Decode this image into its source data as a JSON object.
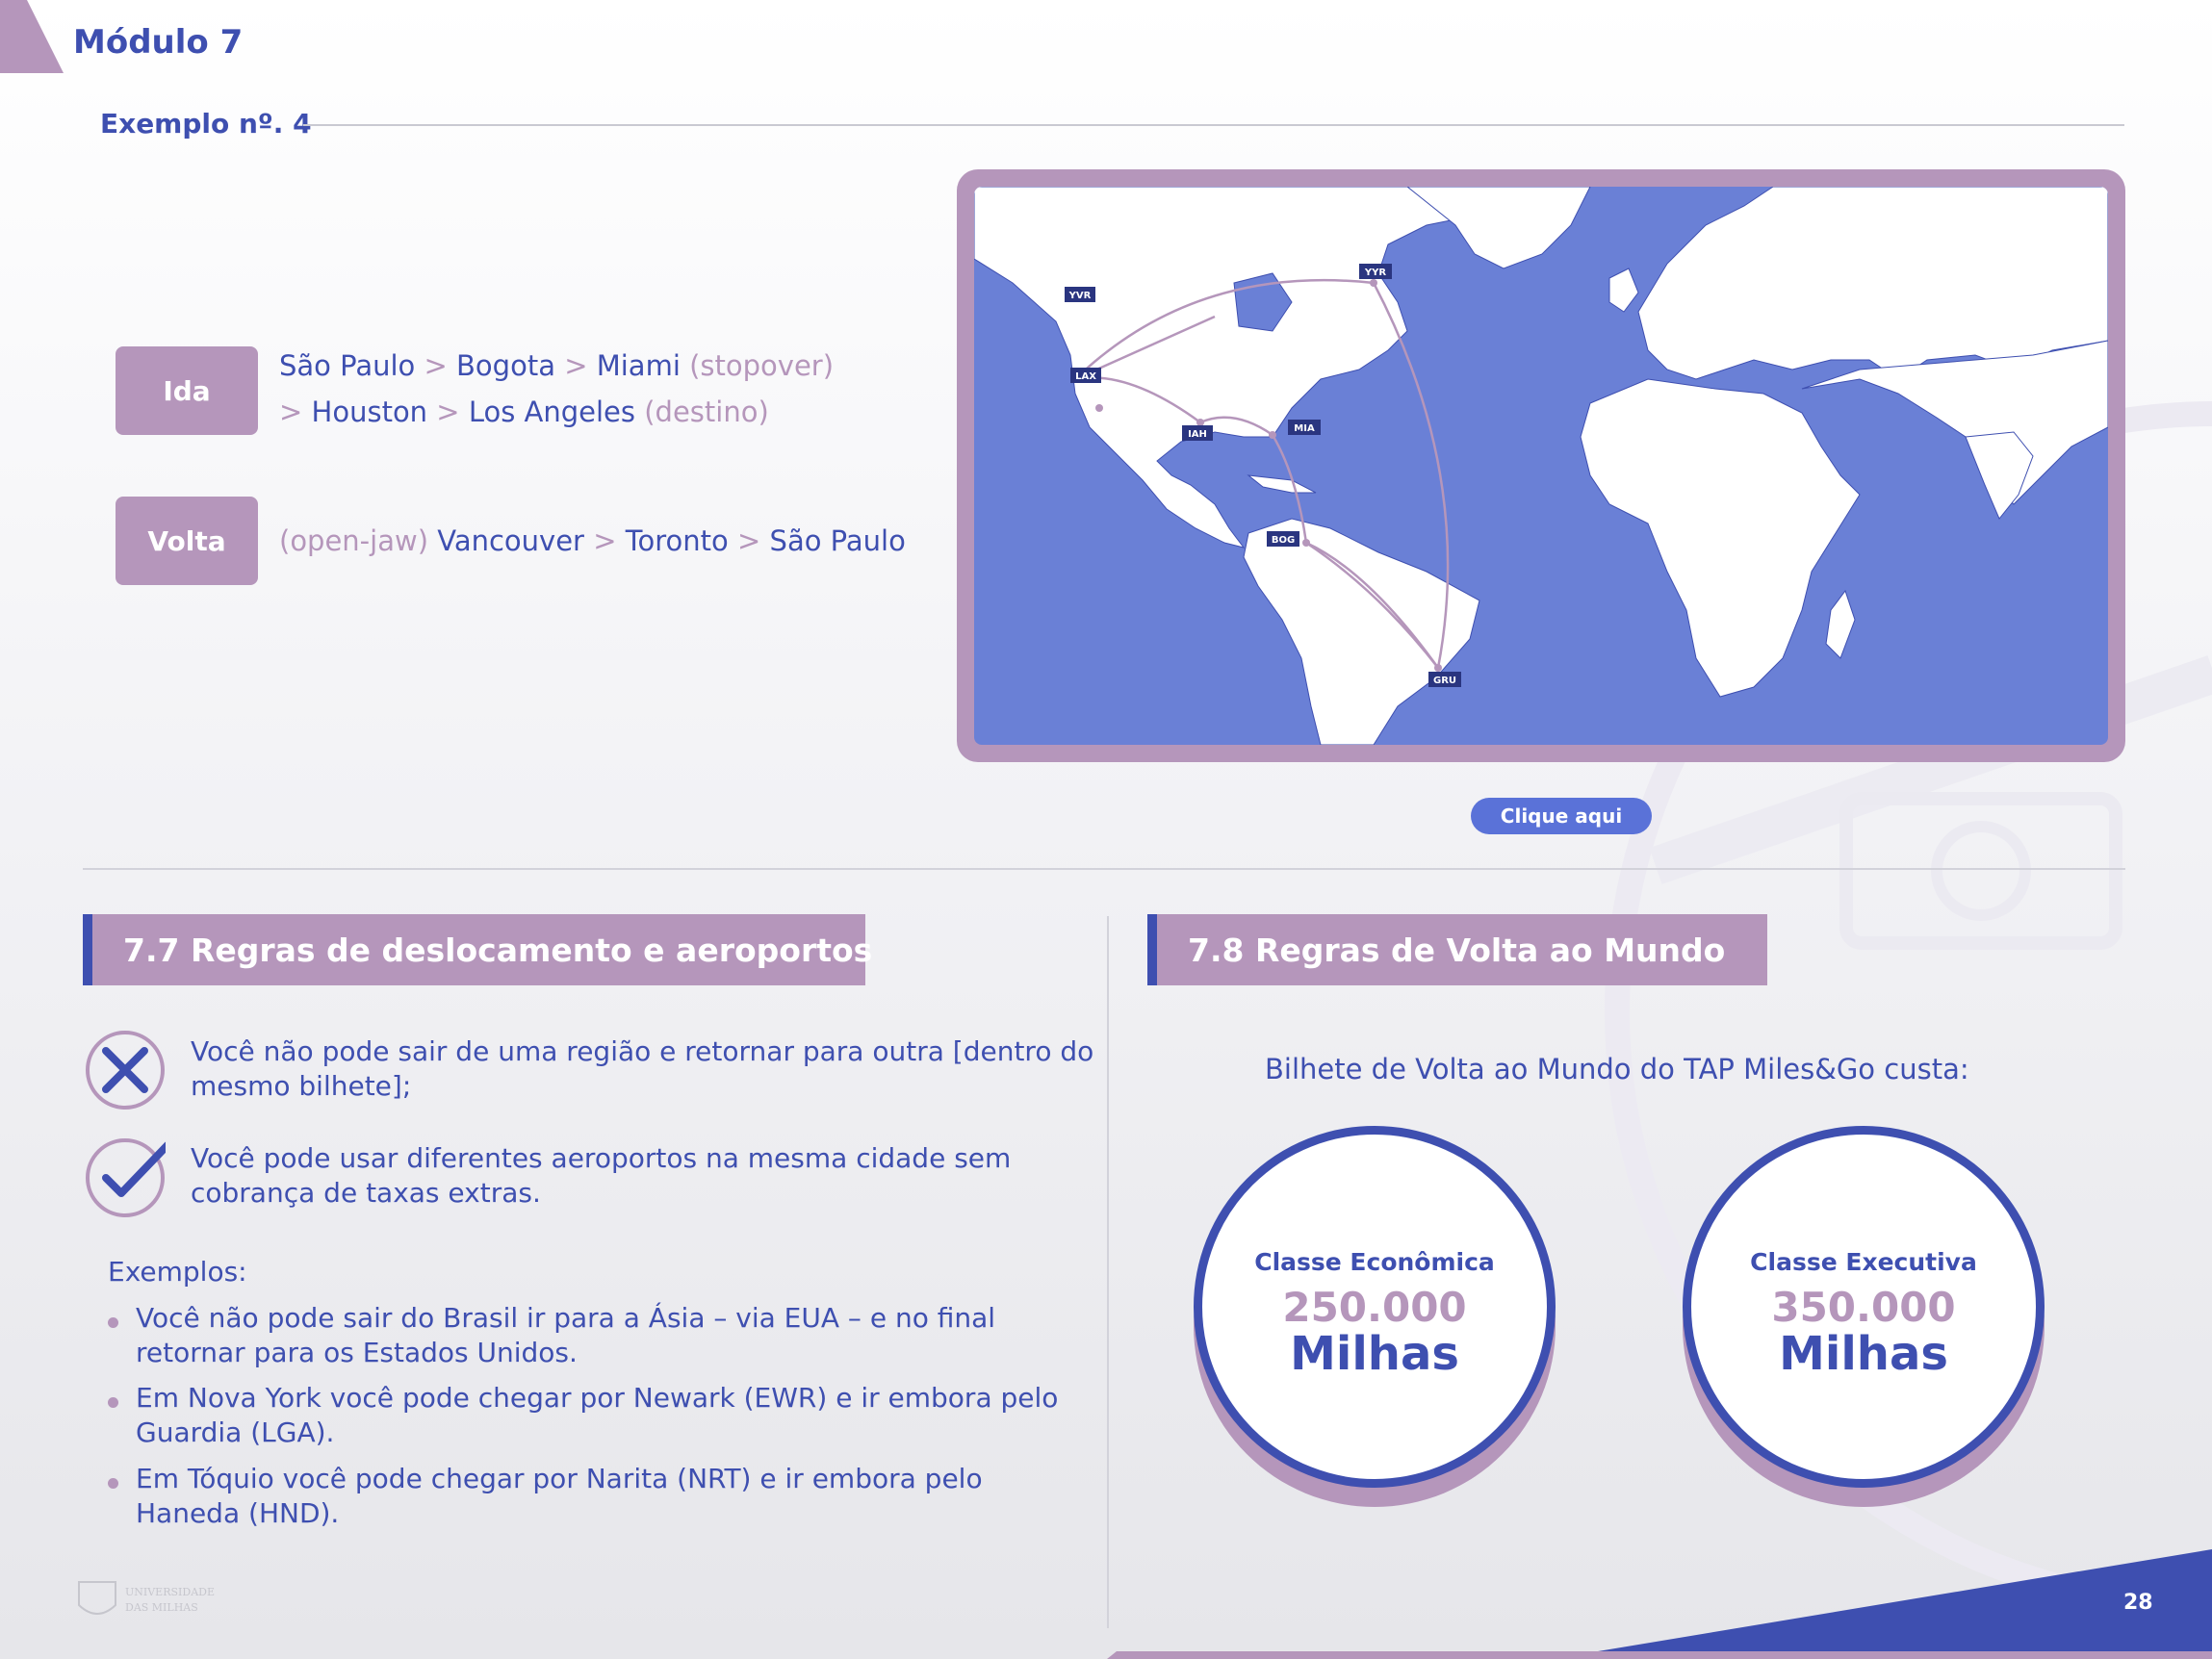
{
  "header": {
    "module_title": "Módulo 7",
    "example_label": "Exemplo nº. 4"
  },
  "route": {
    "ida": {
      "label": "Ida",
      "line1": {
        "a": "São Paulo",
        "b": "Bogota",
        "c": "Miami",
        "note": "(stopover)"
      },
      "line2": {
        "a": "Houston",
        "b": "Los Angeles",
        "note": "(destino)"
      }
    },
    "volta": {
      "label": "Volta",
      "note": "(open-jaw)",
      "a": "Vancouver",
      "b": "Toronto",
      "c": "São Paulo"
    },
    "separator": ">"
  },
  "map": {
    "airports": [
      "YVR",
      "YYR",
      "LAX",
      "IAH",
      "MIA",
      "BOG",
      "GRU"
    ],
    "button_label": "Clique aqui",
    "colors": {
      "ocean": "#6a80d6",
      "land": "#ffffff",
      "route": "#b596bb",
      "tag": "#2a3580"
    }
  },
  "section77": {
    "title": "7.7  Regras de deslocamento e aeroportos",
    "rule_no": "Você não pode sair de uma região e retornar para outra [dentro do mesmo bilhete];",
    "rule_yes": "Você pode usar diferentes aeroportos na mesma cidade sem cobrança de taxas extras.",
    "examples_label": "Exemplos:",
    "examples": [
      "Você não pode sair do Brasil ir para a Ásia – via EUA – e no final retornar para os Estados Unidos.",
      "Em Nova York você pode chegar por Newark (EWR) e ir embora pelo Guardia (LGA).",
      "Em Tóquio você pode chegar por Narita (NRT) e ir embora pelo Haneda (HND)."
    ]
  },
  "section78": {
    "title": "7.8  Regras de Volta ao Mundo",
    "subtitle": "Bilhete de Volta ao Mundo do TAP Miles&Go custa:",
    "cards": [
      {
        "class": "Classe Econômica",
        "value": "250.000",
        "unit": "Milhas"
      },
      {
        "class": "Classe Executiva",
        "value": "350.000",
        "unit": "Milhas"
      }
    ]
  },
  "footer": {
    "page_number": "28",
    "logo_text_1": "UNIVERSIDADE",
    "logo_text_2": "DAS MILHAS"
  },
  "colors": {
    "navy": "#3e4fb0",
    "mauve": "#b596bb",
    "button": "#5a72d8"
  }
}
